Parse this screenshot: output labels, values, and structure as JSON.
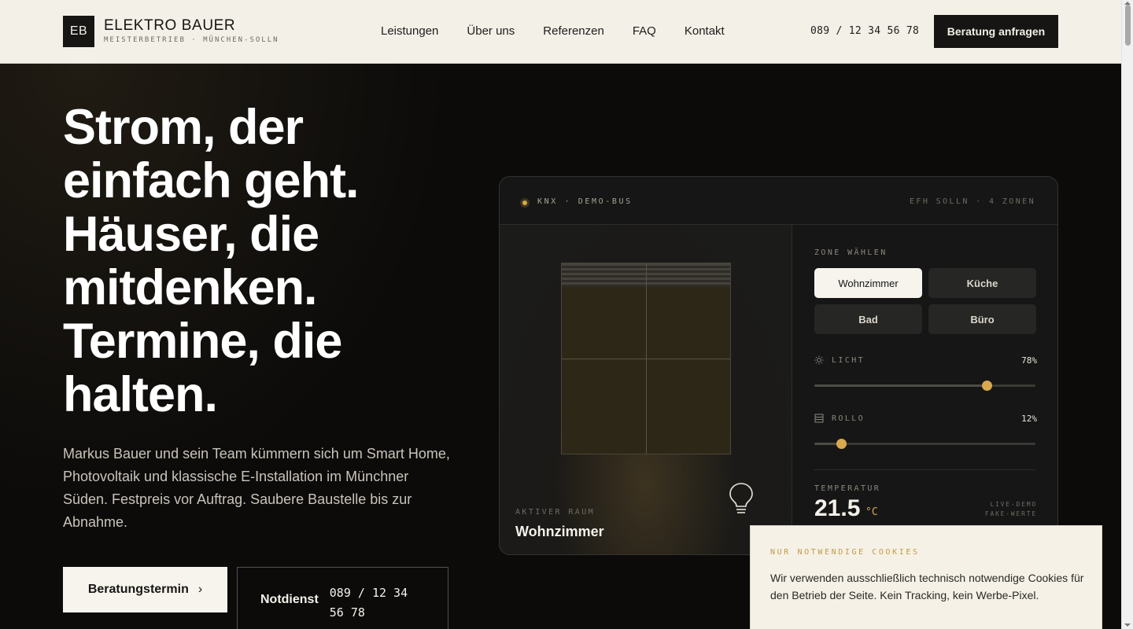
{
  "header": {
    "logo": "EB",
    "brand_name": "ELEKTRO BAUER",
    "brand_sub": "MEISTERBETRIEB · MÜNCHEN-SOLLN",
    "nav": [
      "Leistungen",
      "Über uns",
      "Referenzen",
      "FAQ",
      "Kontakt"
    ],
    "phone": "089 / 12 34 56 78",
    "cta": "Beratung anfragen"
  },
  "hero": {
    "headline": "Strom, der einfach geht. Häuser, die mitdenken. Termine, die halten.",
    "intro": "Markus Bauer und sein Team kümmern sich um Smart Home, Photovoltaik und klassische E-Installation im Münchner Süden. Festpreis vor Auftrag. Saubere Baustelle bis zur Abnahme.",
    "primary_button": "Beratungstermin",
    "primary_button_icon": "chevron-right-icon",
    "notdienst_label": "Notdienst",
    "notdienst_phone": "089 / 12 34 56 78"
  },
  "demo": {
    "tag": "KNX · DEMO-BUS",
    "meta": "EFH SOLLN · 4 ZONEN",
    "active_label": "AKTIVER RAUM",
    "active_room": "Wohnzimmer",
    "zone_label": "ZONE WÄHLEN",
    "zones": [
      "Wohnzimmer",
      "Küche",
      "Bad",
      "Büro"
    ],
    "selected_zone": "Wohnzimmer",
    "light": {
      "label": "LICHT",
      "value_text": "78%",
      "value": 0.78,
      "icon": "sun-icon"
    },
    "blind": {
      "label": "ROLLO",
      "value_text": "12%",
      "value": 0.12,
      "icon": "blind-icon"
    },
    "temperature": {
      "label": "TEMPERATUR",
      "value": "21.5",
      "unit": "°C"
    },
    "note_line1": "LIVE-DEMO",
    "note_line2": "FAKE-WERTE",
    "accent": "#d9a94e"
  },
  "cookie": {
    "title": "NUR NOTWENDIGE COOKIES",
    "text": "Wir verwenden ausschließlich technisch notwendige Cookies für den Betrieb der Seite. Kein Tracking, kein Werbe-Pixel."
  }
}
